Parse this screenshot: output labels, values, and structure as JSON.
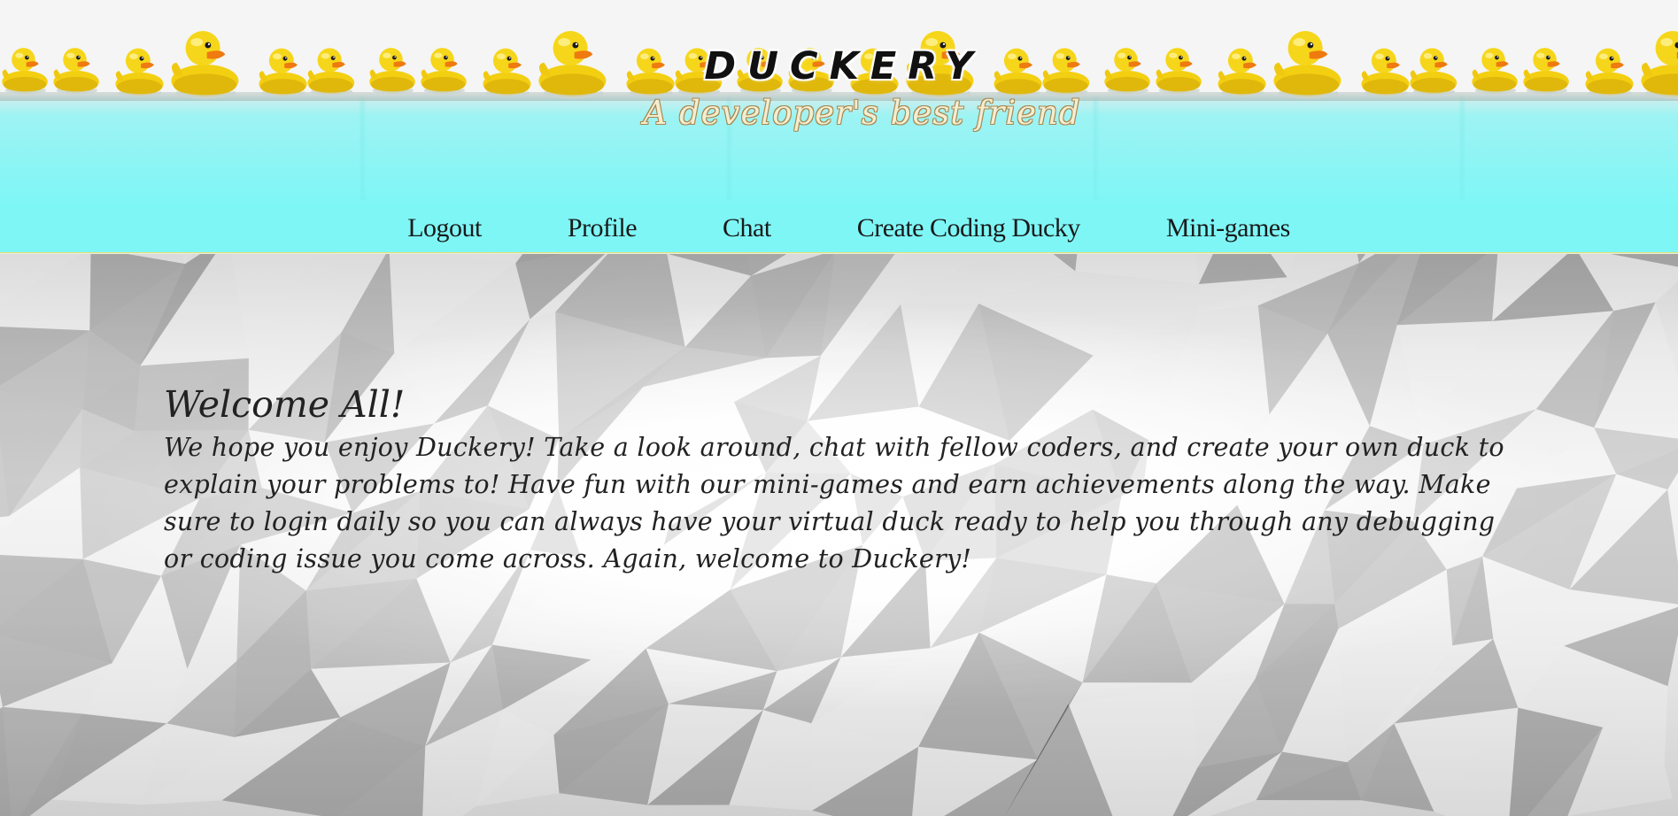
{
  "header": {
    "title": "DUCKERY",
    "subtitle": "A developer's best friend",
    "banner_image": "rubber-duck-row",
    "colors": {
      "water": "#7ef6f6",
      "border": "#e8e36b",
      "subtitle": "#f3eed2"
    }
  },
  "nav": {
    "items": [
      {
        "label": "Logout"
      },
      {
        "label": "Profile"
      },
      {
        "label": "Chat"
      },
      {
        "label": "Create Coding Ducky"
      },
      {
        "label": "Mini-games"
      }
    ]
  },
  "main": {
    "heading": "Welcome All!",
    "body": "We hope you enjoy Duckery! Take a look around, chat with fellow coders, and create your own duck to explain your problems to! Have fun with our mini-games and earn achievements along the way. Make sure to login daily so you can always have your virtual duck ready to help you through any debugging or coding issue you come across. Again, welcome to Duckery!",
    "background": "low-poly-gray"
  }
}
